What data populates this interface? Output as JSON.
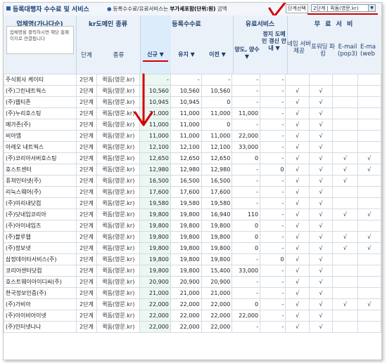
{
  "page": {
    "title": "등록대행자 수수료 및 서비스",
    "notice_prefix": "●",
    "notice_text": "등록수수료/유료서비스는",
    "notice_bold": "부가세포함(단위:원)",
    "notice_suffix": "금액",
    "step_label": "단계선택",
    "step_select_value": "2단계 | 퀵돔(영문.kr)"
  },
  "header": {
    "company": "업체명(가나다순)",
    "company_hint": "업체명을 클릭하시면 해당 홈페이지로 연결됩니다",
    "kr_domain_type": "kr도메인 종류",
    "step": "단계",
    "type": "종류",
    "registration_fee": "등록수수료",
    "new": "신규 ▼",
    "maintain": "유지 ▼",
    "transfer": "이전 ▼",
    "paid_service": "유료서비스",
    "transfer_service": "양도, 양수 ▼",
    "expired_domain": "정지 도메인 갱신 안내 ▼",
    "free_service": "무 료 서 비",
    "free_cols": [
      "네임 서버 제공",
      "포워딩 파킹",
      "E-mail (pop3)",
      "E-ma (web"
    ]
  },
  "rows": [
    {
      "name": "주식회사 케이티",
      "step": "2단계",
      "type": "퀵돔(영문.kr)",
      "new": "-",
      "keep": "-",
      "move": "-",
      "transfer": "-",
      "expired": "-",
      "free": [
        "",
        "",
        "",
        ""
      ]
    },
    {
      "name": "(주)그린네트웍스",
      "step": "2단계",
      "type": "퀵돔(영문.kr)",
      "new": "10,560",
      "keep": "10,560",
      "move": "10,560",
      "transfer": "-",
      "expired": "-",
      "free": [
        "√",
        "√",
        "",
        ""
      ]
    },
    {
      "name": "(주)웹티존",
      "step": "2단계",
      "type": "퀵돔(영문.kr)",
      "new": "10,945",
      "keep": "10,945",
      "move": "0",
      "transfer": "-",
      "expired": "-",
      "free": [
        "√",
        "√",
        "",
        ""
      ]
    },
    {
      "name": "(주)누리호스팅",
      "step": "2단계",
      "type": "퀵돔(영문.kr)",
      "new": "11,000",
      "keep": "11,000",
      "move": "11,000",
      "transfer": "11,000",
      "expired": "-",
      "free": [
        "√",
        "√",
        "",
        ""
      ]
    },
    {
      "name": "메가존(주)",
      "step": "2단계",
      "type": "퀵돔(영문.kr)",
      "new": "11,000",
      "keep": "11,000",
      "move": "0",
      "transfer": "-",
      "expired": "-",
      "free": [
        "√",
        "√",
        "",
        ""
      ]
    },
    {
      "name": "비아엠",
      "step": "2단계",
      "type": "퀵돔(영문.kr)",
      "new": "11,000",
      "keep": "11,000",
      "move": "11,000",
      "transfer": "22,000",
      "expired": "-",
      "free": [
        "√",
        "√",
        "",
        ""
      ]
    },
    {
      "name": "아레오 네트웍스",
      "step": "2단계",
      "type": "퀵돔(영문.kr)",
      "new": "12,100",
      "keep": "12,100",
      "move": "12,100",
      "transfer": "33,000",
      "expired": "-",
      "free": [
        "√",
        "√",
        "",
        ""
      ]
    },
    {
      "name": "(주)코리아서버호스팅",
      "step": "2단계",
      "type": "퀵돔(영문.kr)",
      "new": "12,650",
      "keep": "12,650",
      "move": "12,650",
      "transfer": "0",
      "expired": "-",
      "free": [
        "√",
        "√",
        "√",
        "√"
      ]
    },
    {
      "name": "호스트센터",
      "step": "2단계",
      "type": "퀵돔(영문.kr)",
      "new": "12,980",
      "keep": "12,980",
      "move": "12,980",
      "transfer": "-",
      "expired": "0",
      "free": [
        "√",
        "√",
        "√",
        "√"
      ]
    },
    {
      "name": "퓨쳐인터넷(주)",
      "step": "2단계",
      "type": "퀵돔(영문.kr)",
      "new": "16,500",
      "keep": "16,500",
      "move": "16,500",
      "transfer": "-",
      "expired": "-",
      "free": [
        "√",
        "√",
        "√",
        ""
      ]
    },
    {
      "name": "리눅스웨어(주)",
      "step": "2단계",
      "type": "퀵돔(영문.kr)",
      "new": "17,600",
      "keep": "17,600",
      "move": "17,600",
      "transfer": "-",
      "expired": "-",
      "free": [
        "√",
        "√",
        "",
        ""
      ]
    },
    {
      "name": "(주)미리내닷컴",
      "step": "2단계",
      "type": "퀵돔(영문.kr)",
      "new": "19,580",
      "keep": "19,580",
      "move": "19,580",
      "transfer": "-",
      "expired": "-",
      "free": [
        "√",
        "√",
        "",
        ""
      ]
    },
    {
      "name": "(주)닷네임코리아",
      "step": "2단계",
      "type": "퀵돔(영문.kr)",
      "new": "19,800",
      "keep": "19,800",
      "move": "16,940",
      "transfer": "110",
      "expired": "-",
      "free": [
        "√",
        "√",
        "√",
        "√"
      ]
    },
    {
      "name": "(주)아이네임즈",
      "step": "2단계",
      "type": "퀵돔(영문.kr)",
      "new": "19,800",
      "keep": "19,800",
      "move": "19,800",
      "transfer": "0",
      "expired": "-",
      "free": [
        "√",
        "√",
        "",
        ""
      ]
    },
    {
      "name": "(주)블루웹",
      "step": "2단계",
      "type": "퀵돔(영문.kr)",
      "new": "19,800",
      "keep": "19,800",
      "move": "19,800",
      "transfer": "0",
      "expired": "-",
      "free": [
        "√",
        "√",
        "√",
        "√"
      ]
    },
    {
      "name": "(주)정보넷",
      "step": "2단계",
      "type": "퀵돔(영문.kr)",
      "new": "19,800",
      "keep": "19,800",
      "move": "19,800",
      "transfer": "0",
      "expired": "-",
      "free": [
        "√",
        "√",
        "√",
        "√"
      ]
    },
    {
      "name": "삼정데이타서비스(주)",
      "step": "2단계",
      "type": "퀵돔(영문.kr)",
      "new": "19,800",
      "keep": "19,800",
      "move": "19,800",
      "transfer": "-",
      "expired": "0",
      "free": [
        "√",
        "√",
        "",
        ""
      ]
    },
    {
      "name": "코리아센터닷컴",
      "step": "2단계",
      "type": "퀵돔(영문.kr)",
      "new": "19,800",
      "keep": "19,800",
      "move": "15,400",
      "transfer": "33,000",
      "expired": "-",
      "free": [
        "√",
        "√",
        "",
        ""
      ]
    },
    {
      "name": "호스트웨이아이디씨(주)",
      "step": "2단계",
      "type": "퀵돔(영문.kr)",
      "new": "20,900",
      "keep": "20,900",
      "move": "20,900",
      "transfer": "-",
      "expired": "-",
      "free": [
        "√",
        "√",
        "",
        ""
      ]
    },
    {
      "name": "한국정보인증(주)",
      "step": "2단계",
      "type": "퀵돔(영문.kr)",
      "new": "21,000",
      "keep": "21,000",
      "move": "21,000",
      "transfer": "-",
      "expired": "-",
      "free": [
        "√",
        "√",
        "",
        ""
      ]
    },
    {
      "name": "(주)가비아",
      "step": "2단계",
      "type": "퀵돔(영문.kr)",
      "new": "22,000",
      "keep": "22,000",
      "move": "22,000",
      "transfer": "0",
      "expired": "-",
      "free": [
        "√",
        "√",
        "√",
        "√"
      ]
    },
    {
      "name": "(주)아이비아이넷",
      "step": "2단계",
      "type": "퀵돔(영문.kr)",
      "new": "22,000",
      "keep": "22,000",
      "move": "22,000",
      "transfer": "22,000",
      "expired": "-",
      "free": [
        "√",
        "√",
        "",
        ""
      ]
    },
    {
      "name": "(주)인터넷나나",
      "step": "2단계",
      "type": "퀵돔(영문.kr)",
      "new": "22,000",
      "keep": "22,000",
      "move": "22,000",
      "transfer": "-",
      "expired": "-",
      "free": [
        "√",
        "√",
        "",
        ""
      ]
    }
  ]
}
